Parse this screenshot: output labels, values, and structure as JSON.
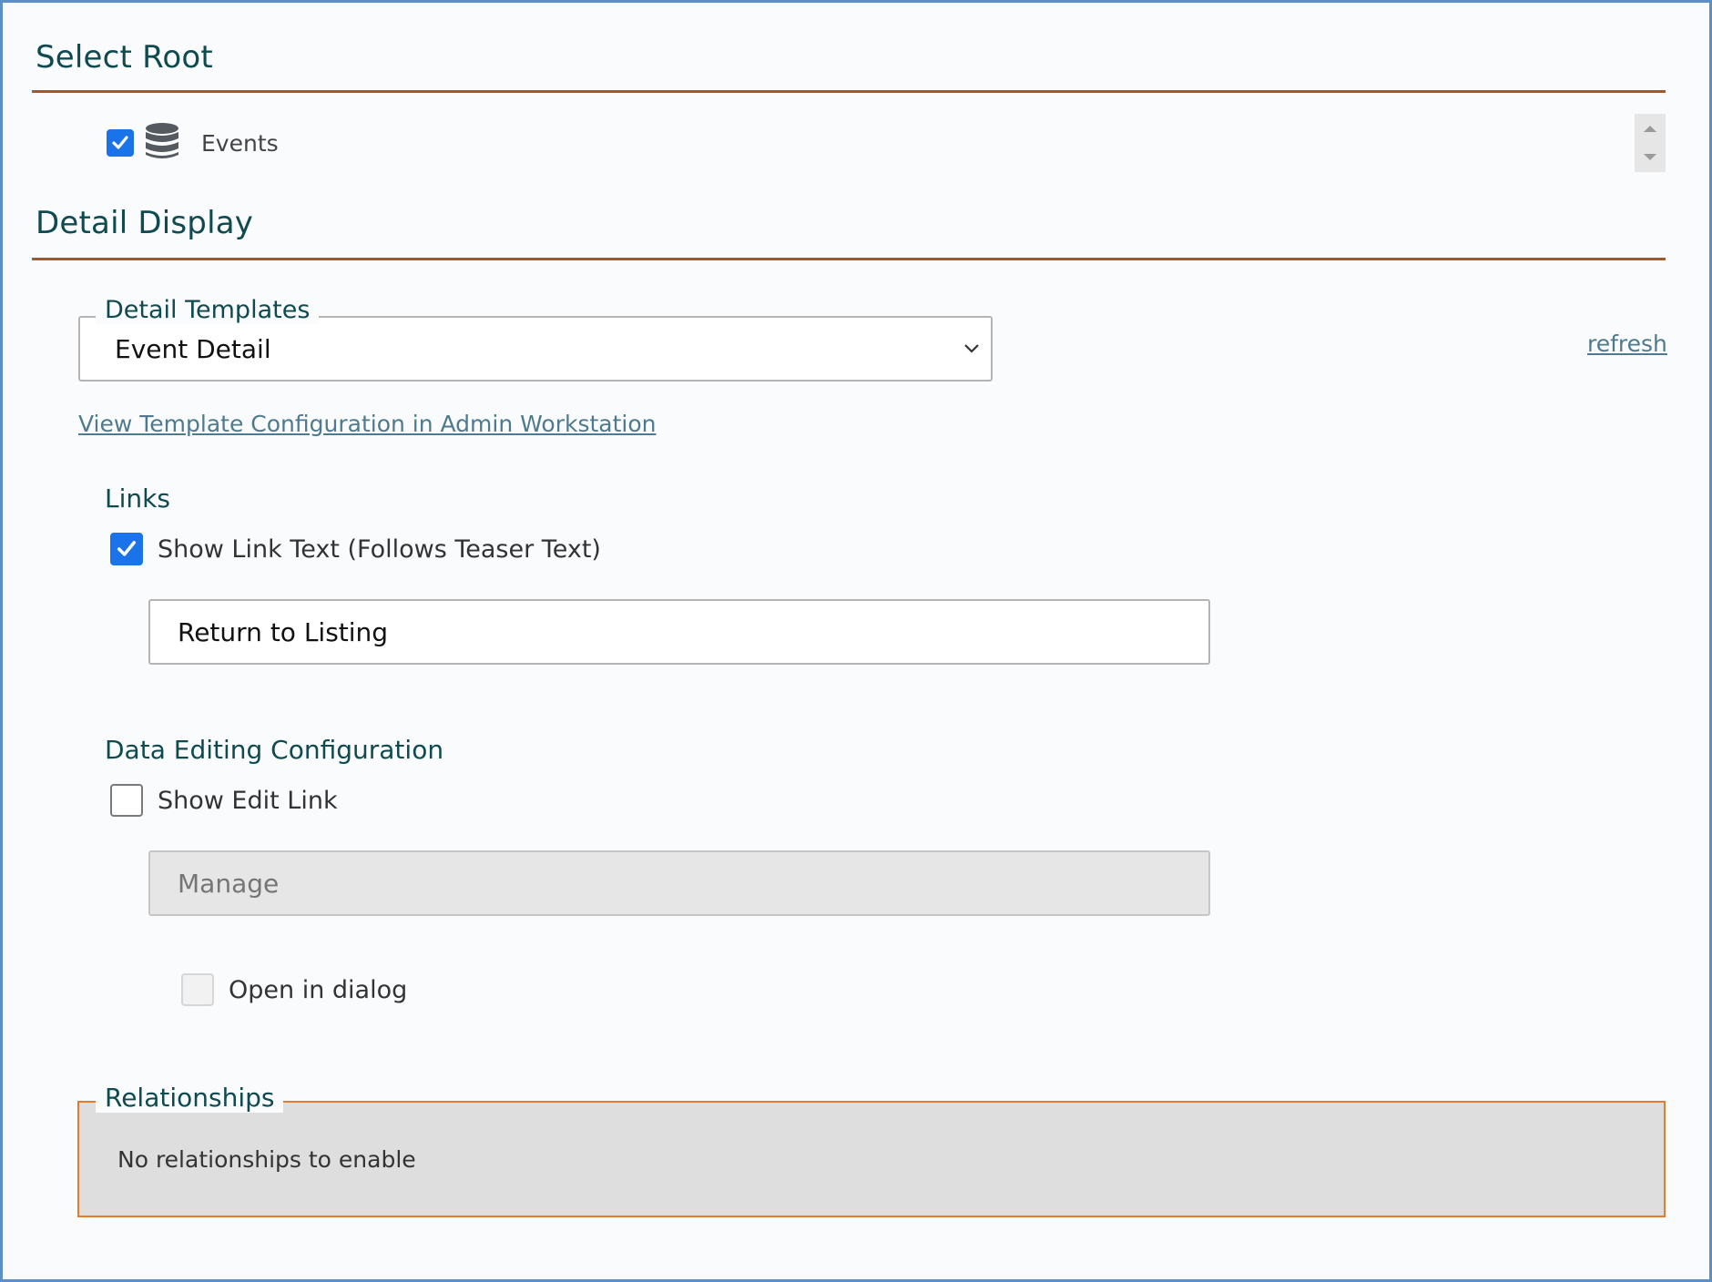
{
  "select_root": {
    "title": "Select Root",
    "item": {
      "label": "Events",
      "checked": true,
      "icon": "database-icon"
    }
  },
  "detail_display": {
    "title": "Detail Display",
    "templates": {
      "legend": "Detail Templates",
      "selected": "Event Detail",
      "refresh_label": "refresh"
    },
    "view_config_link": "View Template Configuration in Admin Workstation",
    "links": {
      "title": "Links",
      "show_link_text_label": "Show Link Text (Follows Teaser Text)",
      "show_link_text_checked": true,
      "link_text_value": "Return to Listing"
    },
    "data_editing": {
      "title": "Data Editing Configuration",
      "show_edit_link_label": "Show Edit Link",
      "show_edit_link_checked": false,
      "edit_link_placeholder": "Manage",
      "open_in_dialog_label": "Open in dialog",
      "open_in_dialog_checked": false
    },
    "relationships": {
      "legend": "Relationships",
      "message": "No relationships to enable"
    }
  },
  "colors": {
    "heading": "#0e4a50",
    "rule": "#a4582a",
    "checkbox": "#1a73e8",
    "link": "#4f7a8e",
    "relationships_border": "#e77b2c"
  }
}
